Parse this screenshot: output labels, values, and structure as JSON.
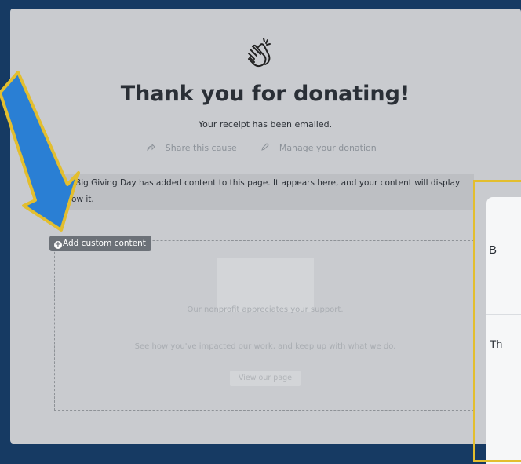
{
  "thank_you": {
    "title": "Thank you for donating!",
    "receipt_text": "Your receipt has been emailed.",
    "share_label": "Share this cause",
    "manage_label": "Manage your donation"
  },
  "notice": {
    "text": "Big Giving Day has added content to this page. It appears here, and your content will display below it."
  },
  "custom_content": {
    "add_label": "Add custom content",
    "placeholder_line1": "Our nonprofit appreciates your support.",
    "placeholder_line2": "See how you've impacted our work, and keep up with what we do.",
    "view_page_label": "View our page"
  },
  "side_panel": {
    "text_top": "B",
    "text_body": "Th"
  },
  "colors": {
    "background": "#163a63",
    "panel": "#c9cbcf",
    "highlight": "#e3be2e",
    "arrow": "#2a7fd4"
  },
  "icons": [
    "clapping-hands-icon",
    "share-icon",
    "pencil-icon",
    "plus-circle-icon"
  ]
}
